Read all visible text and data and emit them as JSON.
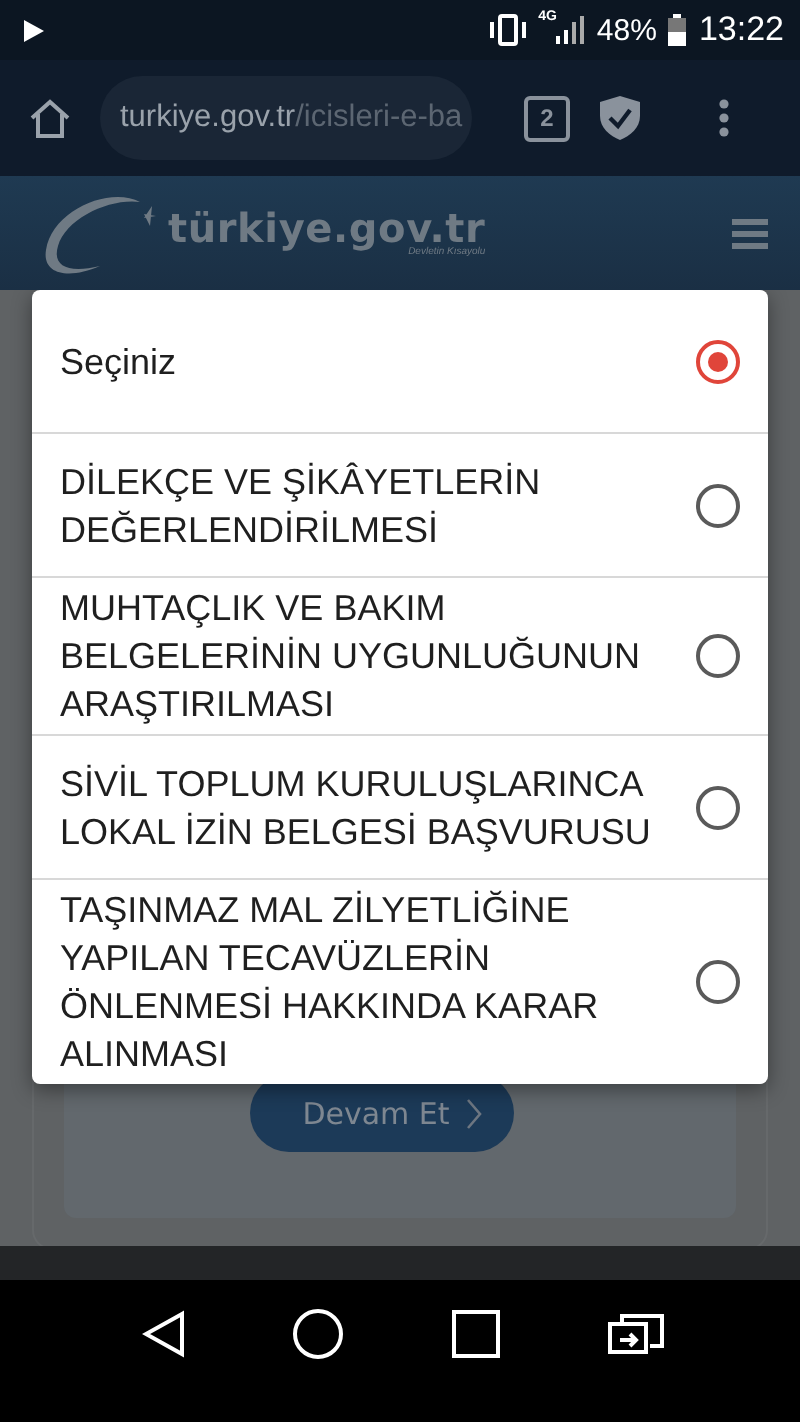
{
  "status_bar": {
    "network": "4G",
    "battery": "48%",
    "time": "13:22"
  },
  "browser": {
    "url_domain": "turkiye.gov.tr",
    "url_path": "/icisleri-e-ba",
    "tab_count": "2"
  },
  "site_header": {
    "logo": "türkiye.gov.tr",
    "tagline": "Devletin Kısayolu"
  },
  "dialog": {
    "options": [
      {
        "label": "Seçiniz",
        "selected": true
      },
      {
        "label": "DİLEKÇE VE ŞİKÂYETLERİN DEĞERLENDİRİLMESİ",
        "selected": false
      },
      {
        "label": "MUHTAÇLIK VE BAKIM BELGELERİNİN UYGUNLUĞUNUN ARAŞTIRILMASI",
        "selected": false
      },
      {
        "label": "SİVİL TOPLUM KURULUŞLARINCA LOKAL İZİN BELGESİ BAŞVURUSU",
        "selected": false
      },
      {
        "label": "TAŞINMAZ MAL ZİLYETLİĞİNE YAPILAN TECAVÜZLERİN ÖNLENMESİ HAKKINDA KARAR ALINMASI",
        "selected": false
      }
    ]
  },
  "page": {
    "button": "Devam Et"
  }
}
